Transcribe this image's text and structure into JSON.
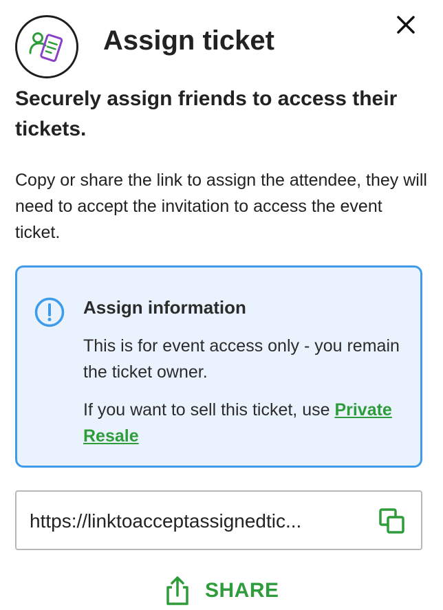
{
  "header": {
    "title": "Assign ticket",
    "avatar_icon": "assign-ticket-icon",
    "close_icon": "close-icon"
  },
  "subtitle": "Securely assign friends to access their tickets.",
  "description": "Copy or share the link to assign the attendee, they will need to accept the invitation to access the event ticket.",
  "info": {
    "icon": "exclamation-circle-icon",
    "heading": "Assign information",
    "text": "This is for event access only - you remain the ticket owner.",
    "resale_prefix": "If you want to sell this ticket, use ",
    "resale_link": "Private Resale"
  },
  "link_field": {
    "value": "https://linktoacceptassignedtic...",
    "copy_icon": "copy-icon"
  },
  "share": {
    "label": "SHARE",
    "icon": "share-icon"
  },
  "colors": {
    "accent_green": "#2e9c3a",
    "info_border": "#3d9be9",
    "info_background": "#eaf3fd",
    "avatar_purple": "#8a3fc7"
  }
}
